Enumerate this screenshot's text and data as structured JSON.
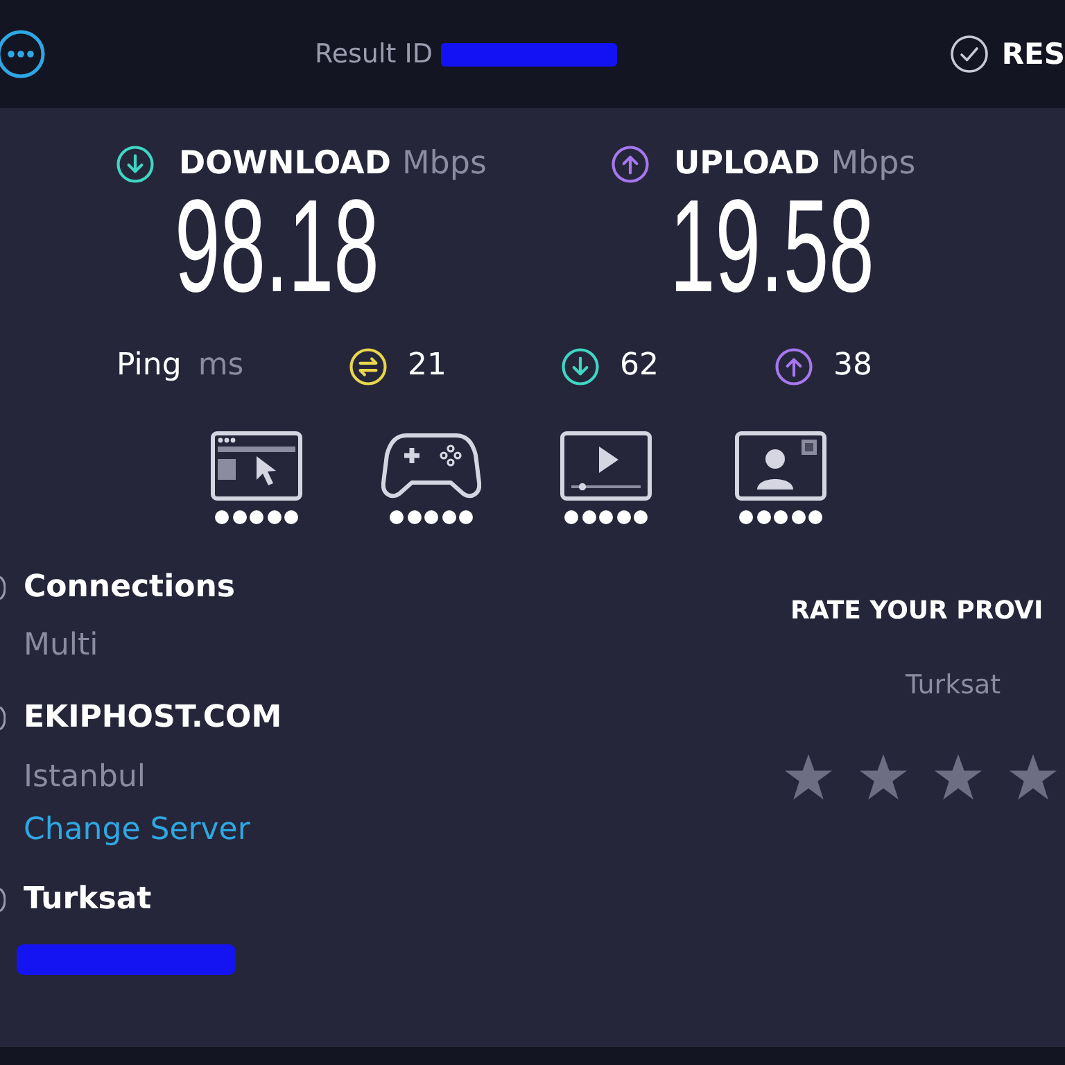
{
  "header": {
    "result_label": "Result ID",
    "results_button": "RES"
  },
  "speeds": [
    {
      "kind": "download",
      "label": "DOWNLOAD",
      "unit": "Mbps",
      "value": "98.18"
    },
    {
      "kind": "upload",
      "label": "UPLOAD",
      "unit": "Mbps",
      "value": "19.58"
    }
  ],
  "ping": {
    "label": "Ping",
    "unit": "ms",
    "readings": [
      {
        "kind": "idle",
        "value": "21"
      },
      {
        "kind": "download",
        "value": "62"
      },
      {
        "kind": "upload",
        "value": "38"
      }
    ]
  },
  "activities": [
    {
      "kind": "browsing",
      "stars": 5
    },
    {
      "kind": "gaming",
      "stars": 5
    },
    {
      "kind": "streaming",
      "stars": 5
    },
    {
      "kind": "video_call",
      "stars": 5
    }
  ],
  "connection": {
    "label": "Connections",
    "value": "Multi"
  },
  "server": {
    "name": "EKIPHOST.COM",
    "location": "Istanbul",
    "change_link": "Change Server"
  },
  "provider": {
    "name": "Turksat"
  },
  "rating": {
    "title": "RATE YOUR PROVI",
    "provider": "Turksat",
    "stars": 0
  }
}
